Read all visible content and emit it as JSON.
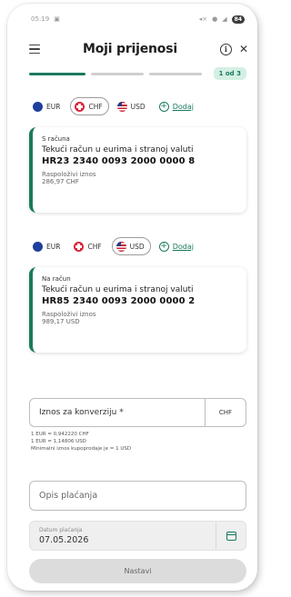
{
  "status_bar": {
    "time": "05:19",
    "left_icon": "notification-icon",
    "battery": "84"
  },
  "header": {
    "title": "Moji prijenosi",
    "menu_icon": "hamburger-icon",
    "info_icon": "info-icon",
    "close_icon": "close-icon"
  },
  "stepper": {
    "badge": "1 od 3",
    "steps": [
      "active",
      "inactive",
      "inactive"
    ]
  },
  "source": {
    "currencies": [
      {
        "code": "EUR",
        "flag": "eu-flag-icon",
        "selected": false
      },
      {
        "code": "CHF",
        "flag": "swiss-flag-icon",
        "selected": true
      },
      {
        "code": "USD",
        "flag": "us-flag-icon",
        "selected": false
      }
    ],
    "add_label": "Dodaj",
    "card": {
      "label": "S računa",
      "title": "Tekući račun u eurima i stranoj valuti",
      "iban": "HR23 2340 0093 2000 0000 8",
      "balance_label": "Raspoloživi iznos",
      "balance": "286,97 CHF"
    }
  },
  "target": {
    "currencies": [
      {
        "code": "EUR",
        "flag": "eu-flag-icon",
        "selected": false
      },
      {
        "code": "CHF",
        "flag": "swiss-flag-icon",
        "selected": false
      },
      {
        "code": "USD",
        "flag": "us-flag-icon",
        "selected": true
      }
    ],
    "add_label": "Dodaj",
    "card": {
      "label": "Na račun",
      "title": "Tekući račun u eurima i stranoj valuti",
      "iban": "HR85 2340 0093 2000 0000 2",
      "balance_label": "Raspoloživi iznos",
      "balance": "989,17 USD"
    }
  },
  "amount": {
    "placeholder": "Iznos za konverziju *",
    "currency": "CHF"
  },
  "rates": {
    "line1": "1 EUR = 0,942220 CHF",
    "line2": "1 EUR = 1,14806 USD",
    "line3": "Minimalni iznos kupoprodaje je = 1 USD"
  },
  "description": {
    "placeholder": "Opis plaćanja"
  },
  "date": {
    "label": "Datum plaćanja",
    "value": "07.05.2026"
  },
  "next_button": {
    "label": "Nastavi"
  },
  "colors": {
    "accent": "#1a7a5e",
    "badge_bg": "#d4efe3",
    "disabled_button": "#dcdcdc"
  }
}
